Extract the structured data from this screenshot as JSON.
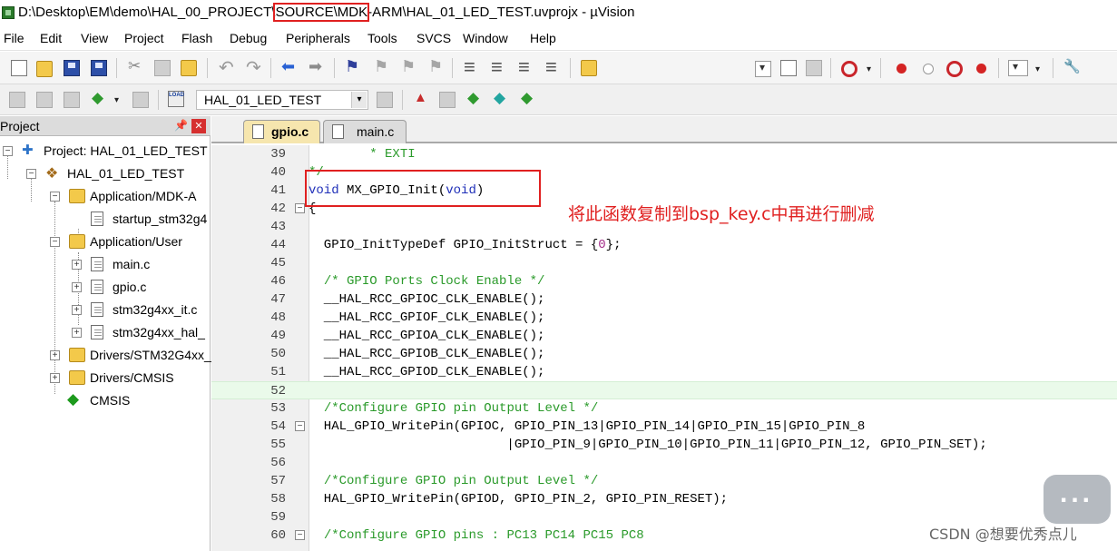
{
  "window": {
    "title_before": "D:\\Desktop\\EM\\demo\\HAL_00_PROJECT\\",
    "title_highlight": "SOURCE\\MDK",
    "title_after": "-ARM\\HAL_01_LED_TEST.uvprojx - µVision"
  },
  "menu": [
    "File",
    "Edit",
    "View",
    "Project",
    "Flash",
    "Debug",
    "Peripherals",
    "Tools",
    "SVCS",
    "Window",
    "Help"
  ],
  "toolbar2": {
    "target": "HAL_01_LED_TEST"
  },
  "project_panel": {
    "title": "Project",
    "tree": [
      "Project: HAL_01_LED_TEST",
      "HAL_01_LED_TEST",
      "Application/MDK-A",
      "startup_stm32g4",
      "Application/User",
      "main.c",
      "gpio.c",
      "stm32g4xx_it.c",
      "stm32g4xx_hal_",
      "Drivers/STM32G4xx_",
      "Drivers/CMSIS",
      "CMSIS"
    ]
  },
  "tabs": [
    "gpio.c",
    "main.c"
  ],
  "code_lines": [
    {
      "n": "39",
      "t": "        * EXTI"
    },
    {
      "n": "40",
      "t": "*/"
    },
    {
      "n": "41",
      "t": "void MX_GPIO_Init(void)"
    },
    {
      "n": "42",
      "t": "{"
    },
    {
      "n": "43",
      "t": ""
    },
    {
      "n": "44",
      "t": "  GPIO_InitTypeDef GPIO_InitStruct = {0};"
    },
    {
      "n": "45",
      "t": ""
    },
    {
      "n": "46",
      "t": "  /* GPIO Ports Clock Enable */"
    },
    {
      "n": "47",
      "t": "  __HAL_RCC_GPIOC_CLK_ENABLE();"
    },
    {
      "n": "48",
      "t": "  __HAL_RCC_GPIOF_CLK_ENABLE();"
    },
    {
      "n": "49",
      "t": "  __HAL_RCC_GPIOA_CLK_ENABLE();"
    },
    {
      "n": "50",
      "t": "  __HAL_RCC_GPIOB_CLK_ENABLE();"
    },
    {
      "n": "51",
      "t": "  __HAL_RCC_GPIOD_CLK_ENABLE();"
    },
    {
      "n": "52",
      "t": ""
    },
    {
      "n": "53",
      "t": "  /*Configure GPIO pin Output Level */"
    },
    {
      "n": "54",
      "t": "  HAL_GPIO_WritePin(GPIOC, GPIO_PIN_13|GPIO_PIN_14|GPIO_PIN_15|GPIO_PIN_8"
    },
    {
      "n": "55",
      "t": "                          |GPIO_PIN_9|GPIO_PIN_10|GPIO_PIN_11|GPIO_PIN_12, GPIO_PIN_SET);"
    },
    {
      "n": "56",
      "t": ""
    },
    {
      "n": "57",
      "t": "  /*Configure GPIO pin Output Level */"
    },
    {
      "n": "58",
      "t": "  HAL_GPIO_WritePin(GPIOD, GPIO_PIN_2, GPIO_PIN_RESET);"
    },
    {
      "n": "59",
      "t": ""
    },
    {
      "n": "60",
      "t": "  /*Configure GPIO pins : PC13 PC14 PC15 PC8"
    }
  ],
  "annotation": "将此函数复制到bsp_key.c中再进行删减",
  "watermark": "CSDN @想要优秀点儿",
  "colors": {
    "comment": "#2a9a2a",
    "keyword": "#1f2fb8",
    "number": "#a42e8a",
    "annotation": "#e02020"
  }
}
